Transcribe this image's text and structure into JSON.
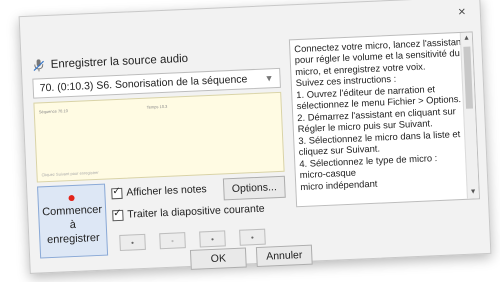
{
  "dialog": {
    "title": "Enregistrer la source audio",
    "close_glyph": "×"
  },
  "slide": {
    "selected": "70. (0:10.3) S6. Sonorisation de la séquence"
  },
  "notes": {
    "line1": "Séquence 70.10",
    "line2": "Temps 10.3",
    "line3": "Cliquez Suivant pour enregistrer"
  },
  "record_button": {
    "label_line1": "Commencer à",
    "label_line2": "enregistrer"
  },
  "checkboxes": [
    {
      "label": "Afficher les notes",
      "checked": true
    },
    {
      "label": "Traiter la diapositive courante",
      "checked": true
    }
  ],
  "options_button": "Options...",
  "small_buttons": [
    "•",
    "•",
    "•",
    "•"
  ],
  "ok_label": "OK",
  "cancel_label": "Annuler",
  "instructions": [
    "Connectez votre micro, lancez l'assistant",
    "pour régler le volume et la sensitivité du",
    "micro, et enregistrez votre voix.",
    "Suivez ces instructions :",
    "1. Ouvrez l'éditeur de narration et",
    "sélectionnez le menu Fichier > Options.",
    "2. Démarrez l'assistant en cliquant sur",
    "Régler le micro puis sur Suivant.",
    "3. Sélectionnez le micro dans la liste et",
    "cliquez sur Suivant.",
    "4. Sélectionnez le type de micro :",
    "micro-casque",
    "micro indépendant"
  ],
  "colors": {
    "notes_bg": "#fffbe3",
    "record_bg": "#dde7f5",
    "record_dot": "#e2231a"
  }
}
